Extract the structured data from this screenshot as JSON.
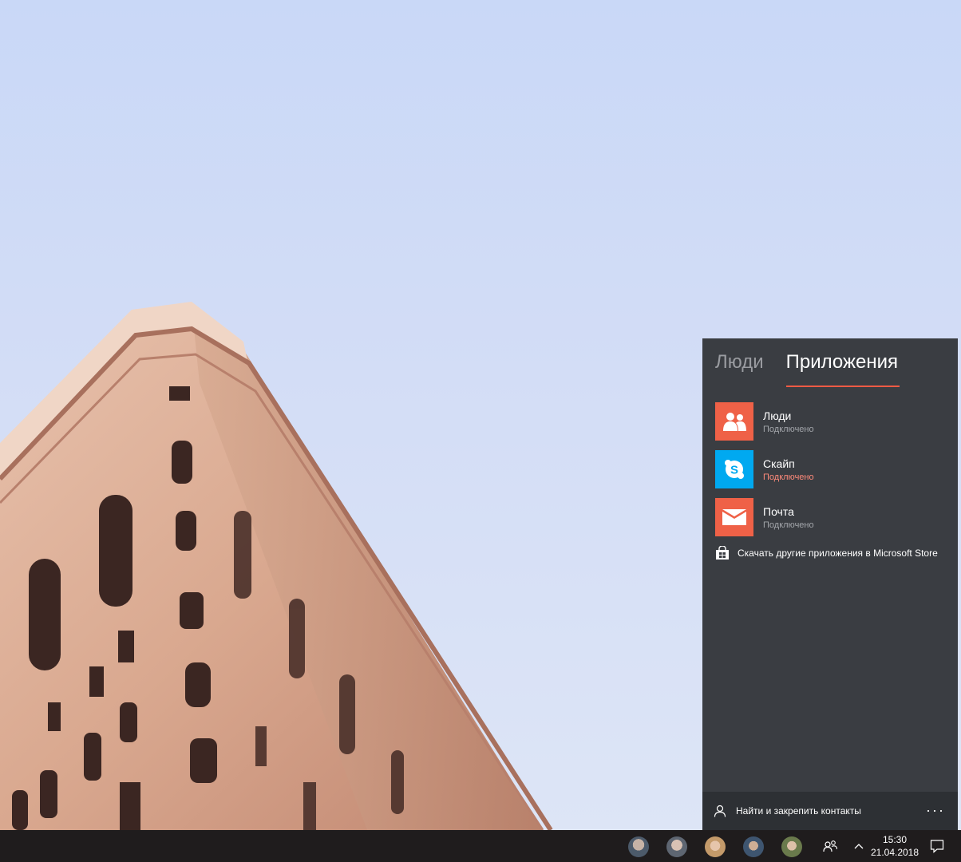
{
  "flyout": {
    "tabs": [
      {
        "label": "Люди",
        "active": false
      },
      {
        "label": "Приложения",
        "active": true
      }
    ],
    "apps": [
      {
        "name": "Люди",
        "status": "Подключено",
        "icon": "people-app-icon",
        "tile_color": "#ef6147"
      },
      {
        "name": "Скайп",
        "status": "Подключено",
        "icon": "skype-icon",
        "tile_color": "#00a9f0"
      },
      {
        "name": "Почта",
        "status": "Подключено",
        "icon": "mail-icon",
        "tile_color": "#ef6147"
      }
    ],
    "store_link": "Скачать другие приложения в Microsoft Store",
    "footer": {
      "find_contacts": "Найти и закрепить контакты",
      "more": "···"
    },
    "accent_color": "#f05a44"
  },
  "taskbar": {
    "pinned_contacts": [
      {
        "icon": "contact-avatar-1"
      },
      {
        "icon": "contact-avatar-2"
      },
      {
        "icon": "contact-avatar-3"
      },
      {
        "icon": "contact-avatar-4"
      },
      {
        "icon": "contact-avatar-5"
      }
    ],
    "time": "15:30",
    "date": "21.04.2018"
  }
}
